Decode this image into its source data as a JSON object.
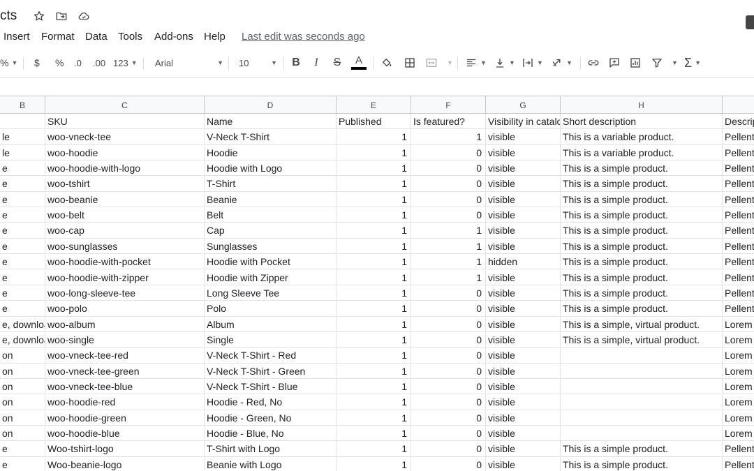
{
  "doc": {
    "title": "cts"
  },
  "menu": {
    "items": [
      "Insert",
      "Format",
      "Data",
      "Tools",
      "Add-ons",
      "Help"
    ],
    "last_edit": "Last edit was seconds ago"
  },
  "toolbar": {
    "percent_fragment": "%",
    "currency": "$",
    "percent": "%",
    "decrease_decimal": ".0",
    "increase_decimal": ".00",
    "number_format": "123",
    "font": "Arial",
    "font_size": "10",
    "icons": [
      "bold-icon",
      "italic-icon",
      "strikethrough-icon",
      "text-color-icon",
      "fill-color-icon",
      "borders-icon",
      "merge-cells-icon",
      "horizontal-align-icon",
      "vertical-align-icon",
      "text-wrap-icon",
      "text-rotation-icon",
      "link-icon",
      "comment-icon",
      "chart-icon",
      "filter-icon",
      "functions-icon"
    ],
    "text_color": "#000000"
  },
  "grid": {
    "columns": [
      "B",
      "C",
      "D",
      "E",
      "F",
      "G",
      "H",
      ""
    ],
    "rows": [
      [
        "",
        "SKU",
        "Name",
        "Published",
        "Is featured?",
        "Visibility in catalog",
        "Short description",
        "Description"
      ],
      [
        "le",
        "woo-vneck-tee",
        "V-Neck T-Shirt",
        "1",
        "1",
        "visible",
        "This is a variable product.",
        "Pellentesque"
      ],
      [
        "le",
        "woo-hoodie",
        "Hoodie",
        "1",
        "0",
        "visible",
        "This is a variable product.",
        "Pellentesque"
      ],
      [
        "e",
        "woo-hoodie-with-logo",
        "Hoodie with Logo",
        "1",
        "0",
        "visible",
        "This is a simple product.",
        "Pellentesque"
      ],
      [
        "e",
        "woo-tshirt",
        "T-Shirt",
        "1",
        "0",
        "visible",
        "This is a simple product.",
        "Pellentesque"
      ],
      [
        "e",
        "woo-beanie",
        "Beanie",
        "1",
        "0",
        "visible",
        "This is a simple product.",
        "Pellentesque"
      ],
      [
        "e",
        "woo-belt",
        "Belt",
        "1",
        "0",
        "visible",
        "This is a simple product.",
        "Pellentesque"
      ],
      [
        "e",
        "woo-cap",
        "Cap",
        "1",
        "1",
        "visible",
        "This is a simple product.",
        "Pellentesque"
      ],
      [
        "e",
        "woo-sunglasses",
        "Sunglasses",
        "1",
        "1",
        "visible",
        "This is a simple product.",
        "Pellentesque"
      ],
      [
        "e",
        "woo-hoodie-with-pocket",
        "Hoodie with Pocket",
        "1",
        "1",
        "hidden",
        "This is a simple product.",
        "Pellentesque"
      ],
      [
        "e",
        "woo-hoodie-with-zipper",
        "Hoodie with Zipper",
        "1",
        "1",
        "visible",
        "This is a simple product.",
        "Pellentesque"
      ],
      [
        "e",
        "woo-long-sleeve-tee",
        "Long Sleeve Tee",
        "1",
        "0",
        "visible",
        "This is a simple product.",
        "Pellentesque"
      ],
      [
        "e",
        "woo-polo",
        "Polo",
        "1",
        "0",
        "visible",
        "This is a simple product.",
        "Pellentesque"
      ],
      [
        "e, downloadable",
        "woo-album",
        "Album",
        "1",
        "0",
        "visible",
        "This is a simple, virtual product.",
        "Lorem"
      ],
      [
        "e, downloadable",
        "woo-single",
        "Single",
        "1",
        "0",
        "visible",
        "This is a simple, virtual product.",
        "Lorem"
      ],
      [
        "on",
        "woo-vneck-tee-red",
        "V-Neck T-Shirt - Red",
        "1",
        "0",
        "visible",
        "",
        "Lorem"
      ],
      [
        "on",
        "woo-vneck-tee-green",
        "V-Neck T-Shirt - Green",
        "1",
        "0",
        "visible",
        "",
        "Lorem"
      ],
      [
        "on",
        "woo-vneck-tee-blue",
        "V-Neck T-Shirt - Blue",
        "1",
        "0",
        "visible",
        "",
        "Lorem"
      ],
      [
        "on",
        "woo-hoodie-red",
        "Hoodie - Red, No",
        "1",
        "0",
        "visible",
        "",
        "Lorem"
      ],
      [
        "on",
        "woo-hoodie-green",
        "Hoodie - Green, No",
        "1",
        "0",
        "visible",
        "",
        "Lorem"
      ],
      [
        "on",
        "woo-hoodie-blue",
        "Hoodie - Blue, No",
        "1",
        "0",
        "visible",
        "",
        "Lorem"
      ],
      [
        "e",
        "Woo-tshirt-logo",
        "T-Shirt with Logo",
        "1",
        "0",
        "visible",
        "This is a simple product.",
        "Pellentesque"
      ],
      [
        "e",
        "Woo-beanie-logo",
        "Beanie with Logo",
        "1",
        "0",
        "visible",
        "This is a simple product.",
        "Pellentesque"
      ]
    ]
  }
}
